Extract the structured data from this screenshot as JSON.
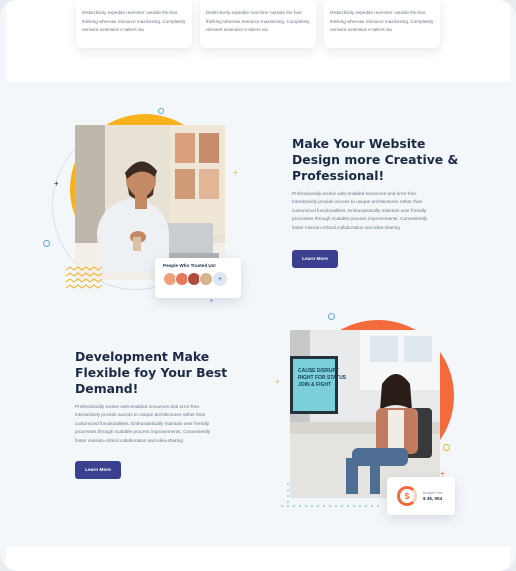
{
  "feature_cards": [
    {
      "text": "Distinctively expedite real-time 'outside the box' thinking whereas resource maximizing. Completely reinvent extensive e-tailers via"
    },
    {
      "text": "Distinctively expedite real-time 'outside the box' thinking whereas resource maximizing. Completely reinvent extensive e-tailers via"
    },
    {
      "text": "Distinctively expedite real-time 'outside the box' thinking whereas resource maximizing. Completely reinvent extensive e-tailers via"
    }
  ],
  "section1": {
    "heading_line1": "Make Your Website",
    "heading_line2": "Design more Creative &",
    "heading_line3": "Professional!",
    "paragraph": "Professionally evolve web-enabled resources and error-free. Interactively provide access to unique architectures rather than customized functionalities. Enthusiastically maintain user friendly processes through scalable process improvements. Conveniently foster mission-critical collaboration and idea-sharing",
    "button_label": "Learn More",
    "trusted_label": "People Who Trusted Us!",
    "trusted_more": "+"
  },
  "section2": {
    "heading_line1": "Development Make",
    "heading_line2": "Flexible foy Your Best",
    "heading_line3": "Demand!",
    "paragraph": "Professionally evolve web-enabled resources and error-free. Interactively provide access to unique architectures rather than customized functionalities. Enthusiastically maintain user friendly processes through scalable process improvements. Conveniently foster mission-critical collaboration and idea-sharing",
    "button_label": "Learn More",
    "monitor_text_line1": "CAUSE DISRUPT",
    "monitor_text_line2": "RIGHT FOR STATUS",
    "monitor_text_line3": "JOIN & FIGHT",
    "budget_label": "Budget Plan",
    "budget_value": "$ 35, 004",
    "budget_icon": "dollar-icon"
  },
  "colors": {
    "accent_orange": "#f36b3a",
    "accent_yellow": "#f7b21c",
    "button_navy": "#3b3f8f",
    "heading_navy": "#1c2b45",
    "ring_blue": "#5aa9d6"
  }
}
